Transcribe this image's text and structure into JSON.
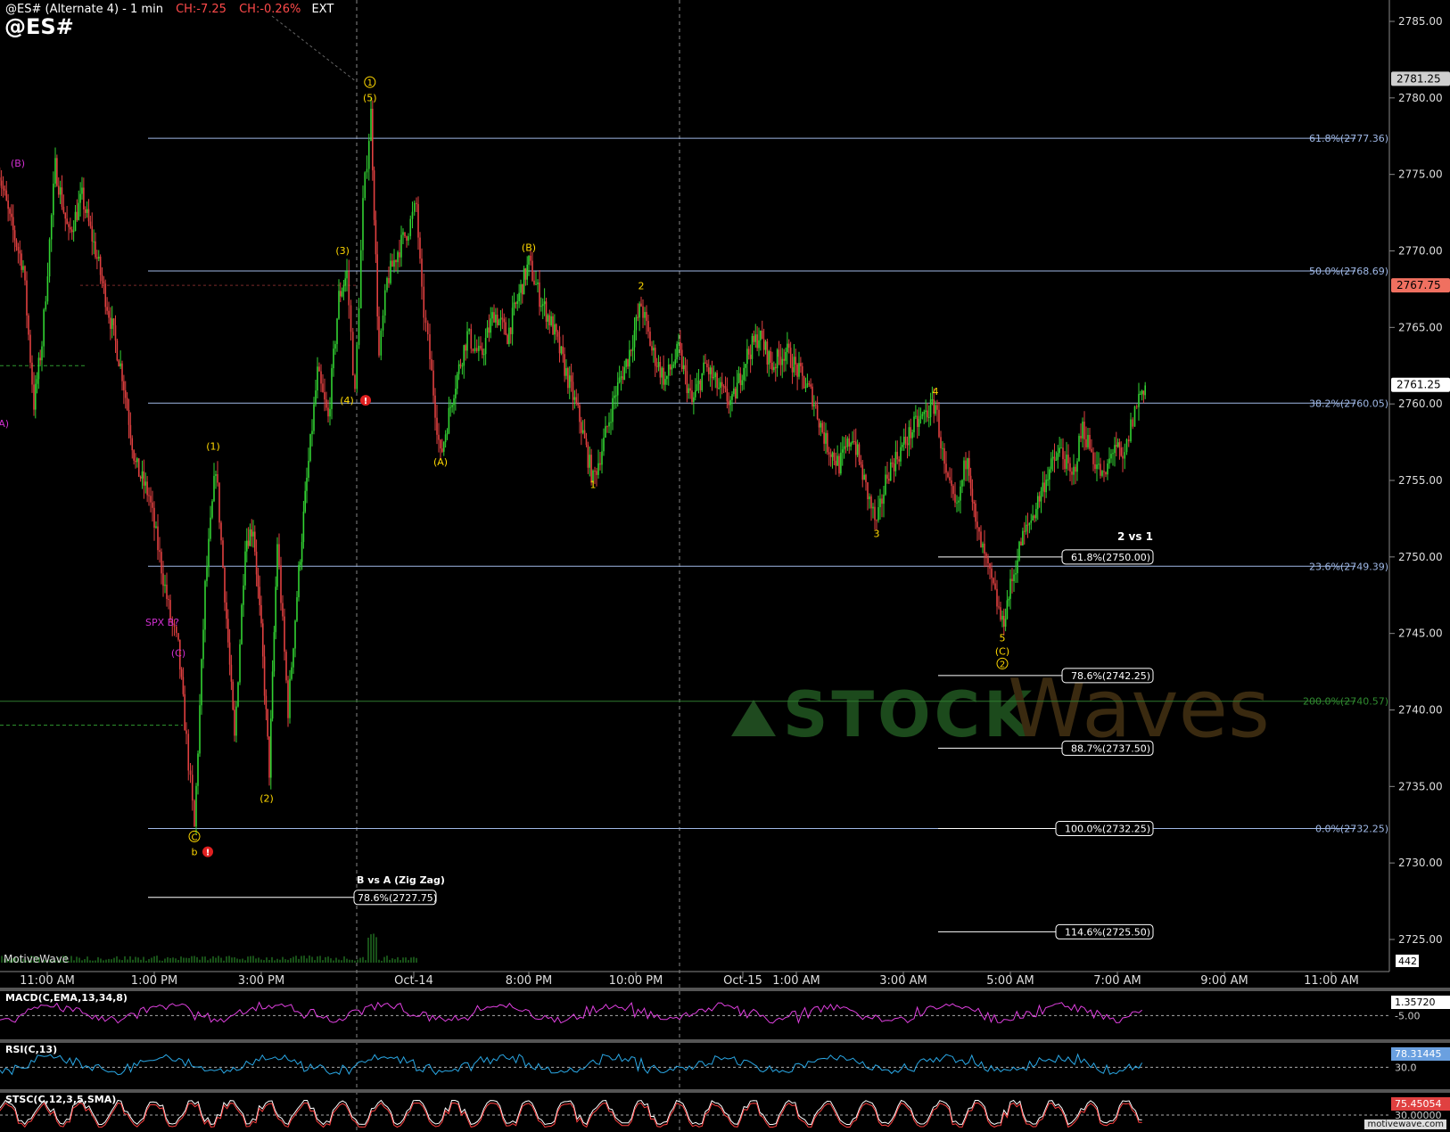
{
  "header": {
    "title": "@ES# (Alternate 4) - 1 min",
    "change_pts": "CH:-7.25",
    "change_pct": "CH:-0.26%",
    "session": "EXT",
    "symbol": "@ES#",
    "brand": "MotiveWave",
    "footer": "motivewave.com"
  },
  "colors": {
    "background": "#000000",
    "up_candle": "#32d232",
    "down_candle": "#e04040",
    "fib_line": "#9fb8e6",
    "wave_label": "#ffd800",
    "b_wave_label": "#d12fd1",
    "macd_line": "#e040e0",
    "macd_hist": "#5aa0e6",
    "rsi_line": "#2aa8e6",
    "stoch_line": "#ffffff",
    "stoch_signal": "#ff4040"
  },
  "chart_data": {
    "type": "line",
    "title": "@ES# (Alternate 4) - 1 min",
    "y_axis": {
      "range": [
        2722.5,
        2787.0
      ],
      "ticks": [
        2725.0,
        2730.0,
        2735.0,
        2740.0,
        2745.0,
        2750.0,
        2755.0,
        2760.0,
        2765.0,
        2770.0,
        2775.0,
        2780.0,
        2785.0
      ],
      "tick_labels": [
        "2725.00",
        "2730.00",
        "2735.00",
        "2740.00",
        "2745.00",
        "2750.00",
        "2755.00",
        "2760.00",
        "2765.00",
        "2770.00",
        "2775.00",
        "2780.00",
        "2785.00"
      ]
    },
    "x_axis": {
      "tick_labels": [
        "11:00 AM",
        "1:00 PM",
        "3:00 PM",
        "Oct-14",
        "8:00 PM",
        "10:00 PM",
        "Oct-15",
        "1:00 AM",
        "3:00 AM",
        "5:00 AM",
        "7:00 AM",
        "9:00 AM",
        "11:00 AM"
      ],
      "tick_hours": [
        -4,
        -2,
        0,
        2.85,
        5,
        7,
        9,
        10,
        12,
        14,
        16,
        18,
        20
      ]
    },
    "price_path": [
      [
        -4.95,
        2776.0
      ],
      [
        -4.7,
        2772.0
      ],
      [
        -4.45,
        2769.0
      ],
      [
        -4.25,
        2760.0
      ],
      [
        -4.1,
        2764.0
      ],
      [
        -3.85,
        2775.5
      ],
      [
        -3.6,
        2771.0
      ],
      [
        -3.35,
        2773.5
      ],
      [
        -3.1,
        2770.0
      ],
      [
        -2.85,
        2766.0
      ],
      [
        -2.6,
        2762.0
      ],
      [
        -2.35,
        2756.0
      ],
      [
        -2.1,
        2754.0
      ],
      [
        -1.9,
        2750.0
      ],
      [
        -1.7,
        2746.0
      ],
      [
        -1.55,
        2744.0
      ],
      [
        -1.4,
        2738.0
      ],
      [
        -1.25,
        2732.25
      ],
      [
        -1.05,
        2748.0
      ],
      [
        -0.85,
        2756.0
      ],
      [
        -0.65,
        2746.0
      ],
      [
        -0.5,
        2738.0
      ],
      [
        -0.3,
        2751.0
      ],
      [
        -0.15,
        2752.0
      ],
      [
        0.0,
        2745.0
      ],
      [
        0.15,
        2736.0
      ],
      [
        0.3,
        2751.0
      ],
      [
        0.5,
        2740.0
      ],
      [
        0.7,
        2749.0
      ],
      [
        0.85,
        2755.0
      ],
      [
        1.05,
        2762.0
      ],
      [
        1.25,
        2759.0
      ],
      [
        1.45,
        2767.0
      ],
      [
        1.6,
        2768.5
      ],
      [
        1.75,
        2760.5
      ],
      [
        1.9,
        2773.0
      ],
      [
        2.05,
        2779.0
      ],
      [
        2.2,
        2763.0
      ],
      [
        2.35,
        2768.0
      ],
      [
        2.55,
        2770.0
      ],
      [
        2.75,
        2771.5
      ],
      [
        2.9,
        2773.0
      ],
      [
        3.0,
        2767.0
      ],
      [
        3.15,
        2763.0
      ],
      [
        3.35,
        2756.5
      ],
      [
        3.6,
        2761.0
      ],
      [
        3.85,
        2764.5
      ],
      [
        4.1,
        2763.0
      ],
      [
        4.35,
        2766.0
      ],
      [
        4.6,
        2764.5
      ],
      [
        4.85,
        2767.5
      ],
      [
        5.0,
        2769.2
      ],
      [
        5.2,
        2767.0
      ],
      [
        5.45,
        2765.0
      ],
      [
        5.7,
        2762.0
      ],
      [
        5.95,
        2759.0
      ],
      [
        6.2,
        2755.0
      ],
      [
        6.4,
        2757.5
      ],
      [
        6.6,
        2760.5
      ],
      [
        6.85,
        2763.0
      ],
      [
        7.1,
        2766.5
      ],
      [
        7.3,
        2763.5
      ],
      [
        7.55,
        2761.5
      ],
      [
        7.8,
        2763.5
      ],
      [
        8.05,
        2760.0
      ],
      [
        8.3,
        2762.5
      ],
      [
        8.55,
        2761.0
      ],
      [
        8.8,
        2760.0
      ],
      [
        9.05,
        2763.0
      ],
      [
        9.3,
        2764.5
      ],
      [
        9.55,
        2762.5
      ],
      [
        9.8,
        2763.5
      ],
      [
        10.05,
        2762.0
      ],
      [
        10.3,
        2760.5
      ],
      [
        10.55,
        2757.5
      ],
      [
        10.8,
        2756.0
      ],
      [
        11.05,
        2758.0
      ],
      [
        11.3,
        2754.5
      ],
      [
        11.5,
        2752.0
      ],
      [
        11.7,
        2755.5
      ],
      [
        11.95,
        2757.0
      ],
      [
        12.2,
        2758.5
      ],
      [
        12.45,
        2759.5
      ],
      [
        12.6,
        2760.0
      ],
      [
        12.8,
        2755.0
      ],
      [
        13.0,
        2753.0
      ],
      [
        13.2,
        2757.0
      ],
      [
        13.35,
        2752.0
      ],
      [
        13.55,
        2749.5
      ],
      [
        13.75,
        2747.0
      ],
      [
        13.85,
        2745.5
      ],
      [
        14.0,
        2748.0
      ],
      [
        14.2,
        2751.0
      ],
      [
        14.45,
        2753.0
      ],
      [
        14.7,
        2755.5
      ],
      [
        14.95,
        2757.0
      ],
      [
        15.15,
        2755.0
      ],
      [
        15.35,
        2758.5
      ],
      [
        15.55,
        2756.5
      ],
      [
        15.75,
        2755.0
      ],
      [
        15.95,
        2757.5
      ],
      [
        16.1,
        2756.0
      ],
      [
        16.25,
        2758.5
      ],
      [
        16.4,
        2760.5
      ],
      [
        16.52,
        2761.25
      ]
    ],
    "fib_levels": [
      {
        "label": "61.8%(2777.36)",
        "value": 2777.36
      },
      {
        "label": "50.0%(2768.69)",
        "value": 2768.69
      },
      {
        "label": "38.2%(2760.05)",
        "value": 2760.05
      },
      {
        "label": "23.6%(2749.39)",
        "value": 2749.39
      },
      {
        "label": "0.0%(2732.25)",
        "value": 2732.25
      }
    ],
    "green_level": {
      "label": "200.0%(2740.57)",
      "value": 2740.57
    },
    "projections": [
      {
        "label": "61.8%(2750.00)",
        "value": 2750.0
      },
      {
        "label": "78.6%(2742.25)",
        "value": 2742.25
      },
      {
        "label": "88.7%(2737.50)",
        "value": 2737.5
      },
      {
        "label": "100.0%(2732.25)",
        "value": 2732.25
      },
      {
        "label": "114.6%(2725.50)",
        "value": 2725.5
      }
    ],
    "projection_title": "2 vs 1",
    "retrace": {
      "title": "B vs A (Zig Zag)",
      "label": "78.6%(2727.75)",
      "value": 2727.75
    },
    "price_badges": [
      {
        "label": "2781.25",
        "value": 2781.25,
        "color": "#cfcfcf"
      },
      {
        "label": "2767.75",
        "value": 2767.75,
        "color": "#f07060"
      },
      {
        "label": "2761.25",
        "value": 2761.25,
        "color": "#ffffff"
      }
    ],
    "wave_labels": [
      {
        "text": "(B)",
        "hour": -4.55,
        "value": 2775.5,
        "color": "#d12fd1"
      },
      {
        "text": "(A)",
        "hour": -4.85,
        "value": 2758.5,
        "color": "#d12fd1"
      },
      {
        "text": "SPX B?",
        "hour": -1.85,
        "value": 2745.5,
        "color": "#d12fd1"
      },
      {
        "text": "(C)",
        "hour": -1.55,
        "value": 2743.5,
        "color": "#d12fd1"
      },
      {
        "text": "(1)",
        "hour": -0.9,
        "value": 2757.0,
        "color": "#ffd800"
      },
      {
        "text": "(2)",
        "hour": 0.1,
        "value": 2734.0,
        "color": "#ffd800"
      },
      {
        "text": "b",
        "hour": -1.25,
        "value": 2730.5,
        "color": "#ffd800"
      },
      {
        "text": "(3)",
        "hour": 1.52,
        "value": 2769.8,
        "color": "#ffd800"
      },
      {
        "text": "(4)",
        "hour": 1.6,
        "value": 2760.0,
        "color": "#ffd800"
      },
      {
        "text": "(5)",
        "hour": 2.03,
        "value": 2779.8,
        "color": "#ffd800"
      },
      {
        "text": "(A)",
        "hour": 3.35,
        "value": 2756.0,
        "color": "#ffd800"
      },
      {
        "text": "(B)",
        "hour": 5.0,
        "value": 2770.0,
        "color": "#ffd800"
      },
      {
        "text": "1",
        "hour": 6.2,
        "value": 2754.5,
        "color": "#ffd800"
      },
      {
        "text": "2",
        "hour": 7.1,
        "value": 2767.5,
        "color": "#ffd800"
      },
      {
        "text": "3",
        "hour": 11.5,
        "value": 2751.3,
        "color": "#ffd800"
      },
      {
        "text": "4",
        "hour": 12.6,
        "value": 2760.6,
        "color": "#ffd800"
      },
      {
        "text": "5",
        "hour": 13.85,
        "value": 2744.5,
        "color": "#ffd800"
      },
      {
        "text": "(C)",
        "hour": 13.85,
        "value": 2743.6,
        "color": "#ffd800"
      }
    ],
    "circle_labels": [
      {
        "text": "1",
        "hour": 2.03,
        "value": 2780.8
      },
      {
        "text": "C",
        "hour": -1.25,
        "value": 2731.5
      },
      {
        "text": "2",
        "hour": 13.85,
        "value": 2742.8
      }
    ],
    "alerts": [
      {
        "hour": 1.95,
        "value": 2760.0
      },
      {
        "hour": -1.0,
        "value": 2730.5
      }
    ],
    "watermark": {
      "stock": "STOCK",
      "waves": "Waves"
    }
  },
  "indicators": {
    "macd": {
      "label": "MACD(C,EMA,13,34,8)",
      "value_label": "1.35720",
      "level_label": "-5.00"
    },
    "rsi": {
      "label": "RSI(C,13)",
      "value_label": "78.31445",
      "level_label": "30.0"
    },
    "stoch": {
      "label": "STSC(C,12,3,5,SMA)",
      "value_label": "75.45054",
      "level_label": "30.00000"
    }
  },
  "volume_label": "442"
}
